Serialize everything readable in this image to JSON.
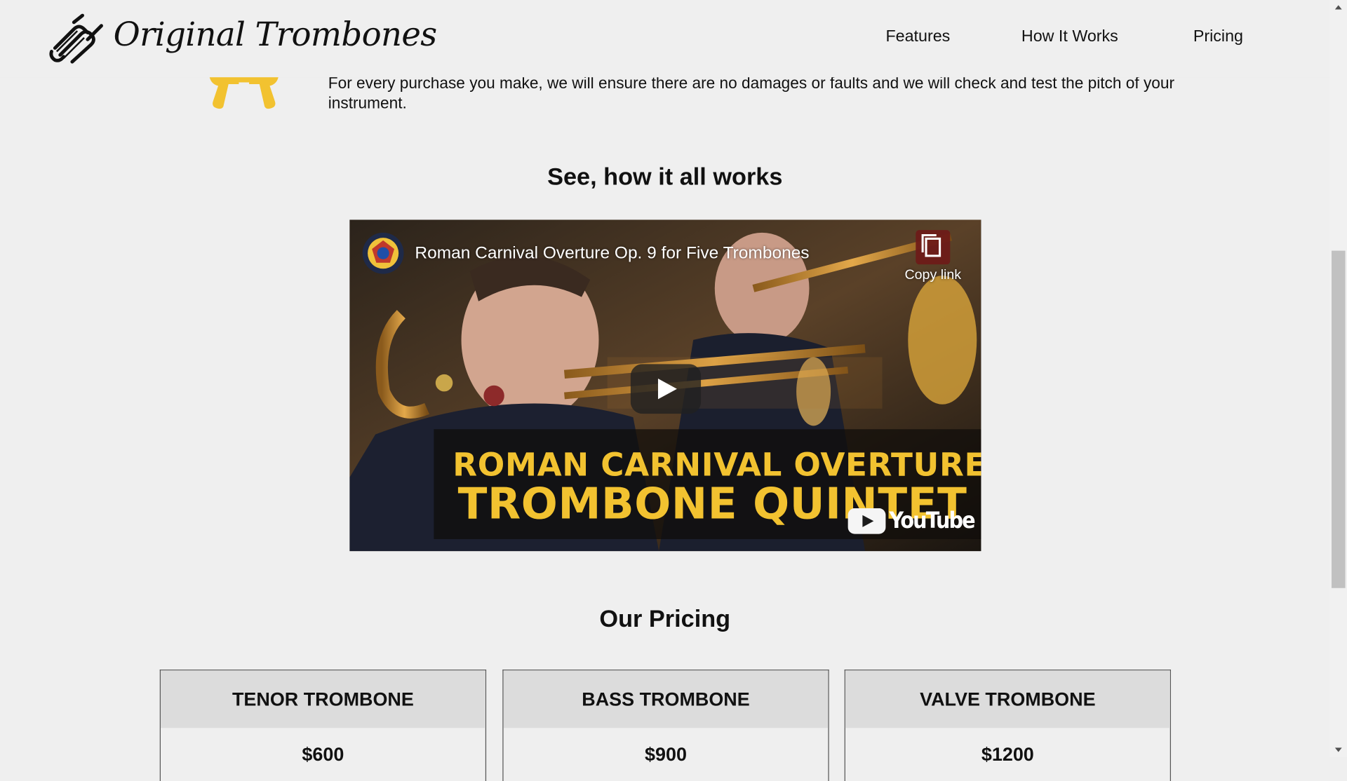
{
  "brand": {
    "name": "Original Trombones"
  },
  "nav": {
    "features": "Features",
    "how_it_works": "How It Works",
    "pricing": "Pricing"
  },
  "feature": {
    "icon": "hand-shake-icon",
    "text": "For every purchase you make, we will ensure there are no damages or faults and we will check and test the pitch of your instrument."
  },
  "how_section": {
    "title": "See, how it all works"
  },
  "video": {
    "title": "Roman Carnival Overture Op. 9 for Five Trombones",
    "copy_link_label": "Copy link",
    "overlay_line1": "ROMAN CARNIVAL OVERTURE",
    "overlay_line2": "TROMBONE QUINTET",
    "provider": "YouTube"
  },
  "pricing_section": {
    "title": "Our Pricing",
    "plans": [
      {
        "name": "TENOR TROMBONE",
        "price": "$600"
      },
      {
        "name": "BASS TROMBONE",
        "price": "$900"
      },
      {
        "name": "VALVE TROMBONE",
        "price": "$1200"
      }
    ]
  },
  "colors": {
    "background": "#efefef",
    "accent_yellow": "#f2c230",
    "card_header": "#dcdcdc",
    "youtube_red": "#ff0000"
  }
}
